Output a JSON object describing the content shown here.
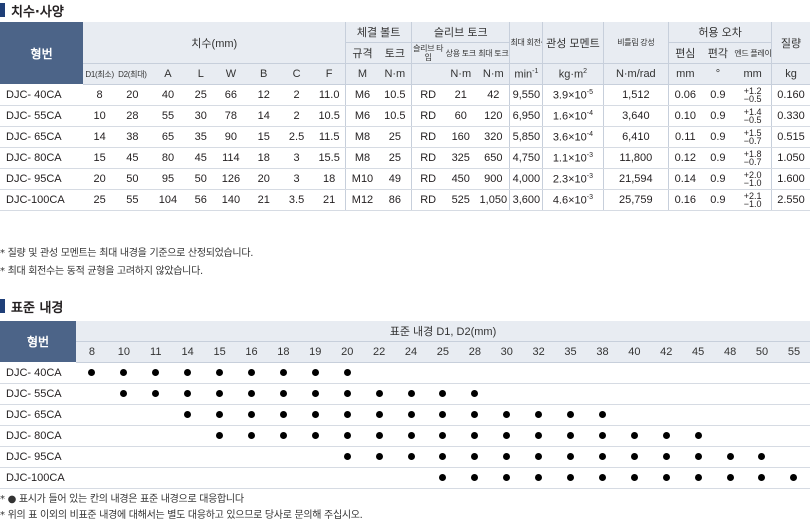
{
  "spec_section": {
    "title": "치수·사양",
    "model_header": "형번",
    "groups": {
      "dims": "치수(mm)",
      "bolt": "체결 볼트",
      "slip": "슬리브 토크",
      "maxrpm": "최대 회전수",
      "inertia": "관성 모멘트",
      "stiff": "비틀림 강성",
      "tol": "허용 오차",
      "mass": "질량"
    },
    "sub_headers": {
      "d1": "D1(최소)",
      "d2": "D2(최대)",
      "a": "A",
      "l": "L",
      "w": "W",
      "b": "B",
      "c": "C",
      "f": "F",
      "bolt_size": "규격",
      "bolt_torque": "토크",
      "slip_type": "슬리브 타 입",
      "slip_rated": "상용 토크",
      "slip_max": "최대 토크",
      "tol_ecc": "편심",
      "tol_ang": "편각",
      "tol_end": "엔드 플레이"
    },
    "units": {
      "m": "M",
      "nm1": "N·m",
      "nm2": "N·m",
      "nm3": "N·m",
      "min": "min",
      "min_sup": "-1",
      "kgm": "kg·m",
      "kgm_sup": "2",
      "nmrad": "N·m/rad",
      "mm": "mm",
      "deg": "°",
      "mm2": "mm",
      "kg": "kg"
    },
    "rows": [
      {
        "model": "DJC- 40CA",
        "d1": "8",
        "d2": "20",
        "a": "40",
        "l": "25",
        "w": "66",
        "b": "12",
        "c": "2",
        "f": "11.0",
        "bolt": "M6",
        "bolt_t": "10.5",
        "type": "RD",
        "rated": "21",
        "max": "42",
        "rpm": "9,550",
        "inertia": "3.9×10",
        "inertia_exp": "-5",
        "stiff": "1,512",
        "ecc": "0.06",
        "ang": "0.9",
        "end_p": "+1.2",
        "end_m": "−0.5",
        "mass": "0.160"
      },
      {
        "model": "DJC- 55CA",
        "d1": "10",
        "d2": "28",
        "a": "55",
        "l": "30",
        "w": "78",
        "b": "14",
        "c": "2",
        "f": "10.5",
        "bolt": "M6",
        "bolt_t": "10.5",
        "type": "RD",
        "rated": "60",
        "max": "120",
        "rpm": "6,950",
        "inertia": "1.6×10",
        "inertia_exp": "-4",
        "stiff": "3,640",
        "ecc": "0.10",
        "ang": "0.9",
        "end_p": "+1.4",
        "end_m": "−0.5",
        "mass": "0.330"
      },
      {
        "model": "DJC- 65CA",
        "d1": "14",
        "d2": "38",
        "a": "65",
        "l": "35",
        "w": "90",
        "b": "15",
        "c": "2.5",
        "f": "11.5",
        "bolt": "M8",
        "bolt_t": "25",
        "type": "RD",
        "rated": "160",
        "max": "320",
        "rpm": "5,850",
        "inertia": "3.6×10",
        "inertia_exp": "-4",
        "stiff": "6,410",
        "ecc": "0.11",
        "ang": "0.9",
        "end_p": "+1.5",
        "end_m": "−0.7",
        "mass": "0.515"
      },
      {
        "model": "DJC- 80CA",
        "d1": "15",
        "d2": "45",
        "a": "80",
        "l": "45",
        "w": "114",
        "b": "18",
        "c": "3",
        "f": "15.5",
        "bolt": "M8",
        "bolt_t": "25",
        "type": "RD",
        "rated": "325",
        "max": "650",
        "rpm": "4,750",
        "inertia": "1.1×10",
        "inertia_exp": "-3",
        "stiff": "11,800",
        "ecc": "0.12",
        "ang": "0.9",
        "end_p": "+1.8",
        "end_m": "−0.7",
        "mass": "1.050"
      },
      {
        "model": "DJC- 95CA",
        "d1": "20",
        "d2": "50",
        "a": "95",
        "l": "50",
        "w": "126",
        "b": "20",
        "c": "3",
        "f": "18",
        "bolt": "M10",
        "bolt_t": "49",
        "type": "RD",
        "rated": "450",
        "max": "900",
        "rpm": "4,000",
        "inertia": "2.3×10",
        "inertia_exp": "-3",
        "stiff": "21,594",
        "ecc": "0.14",
        "ang": "0.9",
        "end_p": "+2.0",
        "end_m": "−1.0",
        "mass": "1.600"
      },
      {
        "model": "DJC-100CA",
        "d1": "25",
        "d2": "55",
        "a": "104",
        "l": "56",
        "w": "140",
        "b": "21",
        "c": "3.5",
        "f": "21",
        "bolt": "M12",
        "bolt_t": "86",
        "type": "RD",
        "rated": "525",
        "max": "1,050",
        "rpm": "3,600",
        "inertia": "4.6×10",
        "inertia_exp": "-3",
        "stiff": "25,759",
        "ecc": "0.16",
        "ang": "0.9",
        "end_p": "+2.1",
        "end_m": "−1.0",
        "mass": "2.550"
      }
    ],
    "notes": [
      "* 질량 및 관성 모멘트는 최대 내경을 기준으로 산정되었습니다.",
      "* 최대 회전수는 동적 균형을 고려하지 않았습니다."
    ]
  },
  "bore_section": {
    "title": "표준 내경",
    "model_header": "형번",
    "group_header": "표준 내경 D1, D2(mm)",
    "sizes": [
      "8",
      "10",
      "11",
      "14",
      "15",
      "16",
      "18",
      "19",
      "20",
      "22",
      "24",
      "25",
      "28",
      "30",
      "32",
      "35",
      "38",
      "40",
      "42",
      "45",
      "48",
      "50",
      "55"
    ],
    "rows": [
      {
        "model": "DJC- 40CA",
        "marks": [
          1,
          1,
          1,
          1,
          1,
          1,
          1,
          1,
          1,
          0,
          0,
          0,
          0,
          0,
          0,
          0,
          0,
          0,
          0,
          0,
          0,
          0,
          0
        ]
      },
      {
        "model": "DJC- 55CA",
        "marks": [
          0,
          1,
          1,
          1,
          1,
          1,
          1,
          1,
          1,
          1,
          1,
          1,
          1,
          0,
          0,
          0,
          0,
          0,
          0,
          0,
          0,
          0,
          0
        ]
      },
      {
        "model": "DJC- 65CA",
        "marks": [
          0,
          0,
          0,
          1,
          1,
          1,
          1,
          1,
          1,
          1,
          1,
          1,
          1,
          1,
          1,
          1,
          1,
          0,
          0,
          0,
          0,
          0,
          0
        ]
      },
      {
        "model": "DJC- 80CA",
        "marks": [
          0,
          0,
          0,
          0,
          1,
          1,
          1,
          1,
          1,
          1,
          1,
          1,
          1,
          1,
          1,
          1,
          1,
          1,
          1,
          1,
          0,
          0,
          0
        ]
      },
      {
        "model": "DJC- 95CA",
        "marks": [
          0,
          0,
          0,
          0,
          0,
          0,
          0,
          0,
          1,
          1,
          1,
          1,
          1,
          1,
          1,
          1,
          1,
          1,
          1,
          1,
          1,
          1,
          0
        ]
      },
      {
        "model": "DJC-100CA",
        "marks": [
          0,
          0,
          0,
          0,
          0,
          0,
          0,
          0,
          0,
          0,
          0,
          1,
          1,
          1,
          1,
          1,
          1,
          1,
          1,
          1,
          1,
          1,
          1
        ]
      }
    ],
    "notes": [
      "* ● 표시가 들어 있는 칸의 내경은 표준 내경으로 대응합니다",
      "* 위의 표 이외의 비표준 내경에 대해서는 별도 대응하고 있으므로 당사로 문의해 주십시오."
    ]
  }
}
